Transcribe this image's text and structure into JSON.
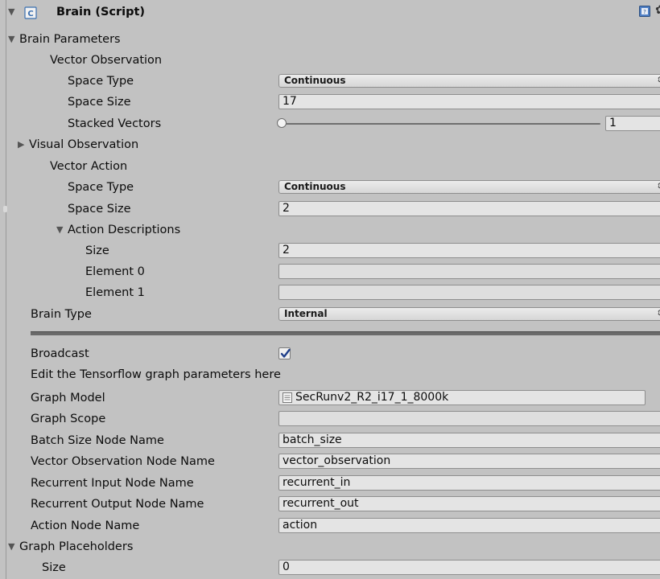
{
  "component": {
    "title": "Brain (Script)"
  },
  "brain_parameters": {
    "label": "Brain Parameters",
    "vector_observation": {
      "label": "Vector Observation",
      "space_type_label": "Space Type",
      "space_type_value": "Continuous",
      "space_size_label": "Space Size",
      "space_size_value": "17",
      "stacked_vectors_label": "Stacked Vectors",
      "stacked_vectors_value": "1"
    },
    "visual_observation": {
      "label": "Visual Observation"
    },
    "vector_action": {
      "label": "Vector Action",
      "space_type_label": "Space Type",
      "space_type_value": "Continuous",
      "space_size_label": "Space Size",
      "space_size_value": "2",
      "action_descriptions": {
        "label": "Action Descriptions",
        "size_label": "Size",
        "size_value": "2",
        "elements": [
          {
            "label": "Element 0",
            "value": ""
          },
          {
            "label": "Element 1",
            "value": ""
          }
        ]
      }
    }
  },
  "brain_type": {
    "label": "Brain Type",
    "value": "Internal"
  },
  "internal": {
    "broadcast_label": "Broadcast",
    "broadcast_checked": true,
    "info_text": "Edit the Tensorflow graph parameters here",
    "graph_model_label": "Graph Model",
    "graph_model_value": "SecRunv2_R2_i17_1_8000k",
    "graph_scope_label": "Graph Scope",
    "graph_scope_value": "",
    "batch_size_label": "Batch Size Node Name",
    "batch_size_value": "batch_size",
    "vector_obs_label": "Vector Observation Node Name",
    "vector_obs_value": "vector_observation",
    "recurrent_in_label": "Recurrent Input Node Name",
    "recurrent_in_value": "recurrent_in",
    "recurrent_out_label": "Recurrent Output Node Name",
    "recurrent_out_value": "recurrent_out",
    "action_label": "Action Node Name",
    "action_value": "action",
    "graph_placeholders": {
      "label": "Graph Placeholders",
      "size_label": "Size",
      "size_value": "0"
    }
  }
}
